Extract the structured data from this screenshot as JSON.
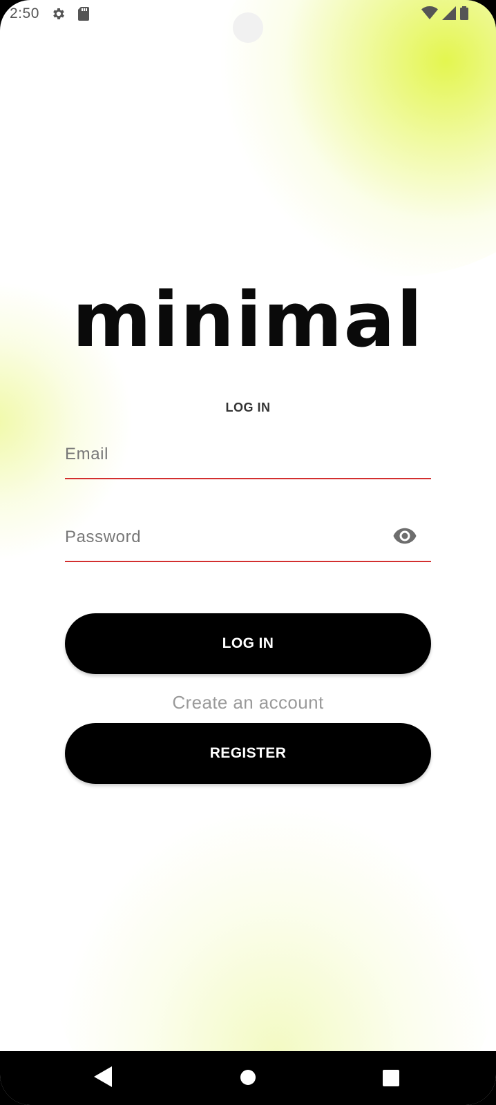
{
  "status_bar": {
    "time": "2:50"
  },
  "app": {
    "logo_text": "minimal",
    "heading": "LOG IN"
  },
  "form": {
    "email_placeholder": "Email",
    "email_value": "",
    "password_placeholder": "Password",
    "password_value": ""
  },
  "actions": {
    "login_label": "LOG IN",
    "create_account_label": "Create an account",
    "register_label": "REGISTER"
  },
  "colors": {
    "accent_lime": "#e2f546",
    "field_underline_error": "#d32f2f",
    "button_bg": "#000000"
  },
  "icons": {
    "status": [
      "gear-icon",
      "sd-card-icon",
      "wifi-icon",
      "signal-icon",
      "battery-icon"
    ],
    "password_toggle": "eye-icon",
    "navigation": [
      "back-icon",
      "home-icon",
      "recents-icon"
    ]
  }
}
